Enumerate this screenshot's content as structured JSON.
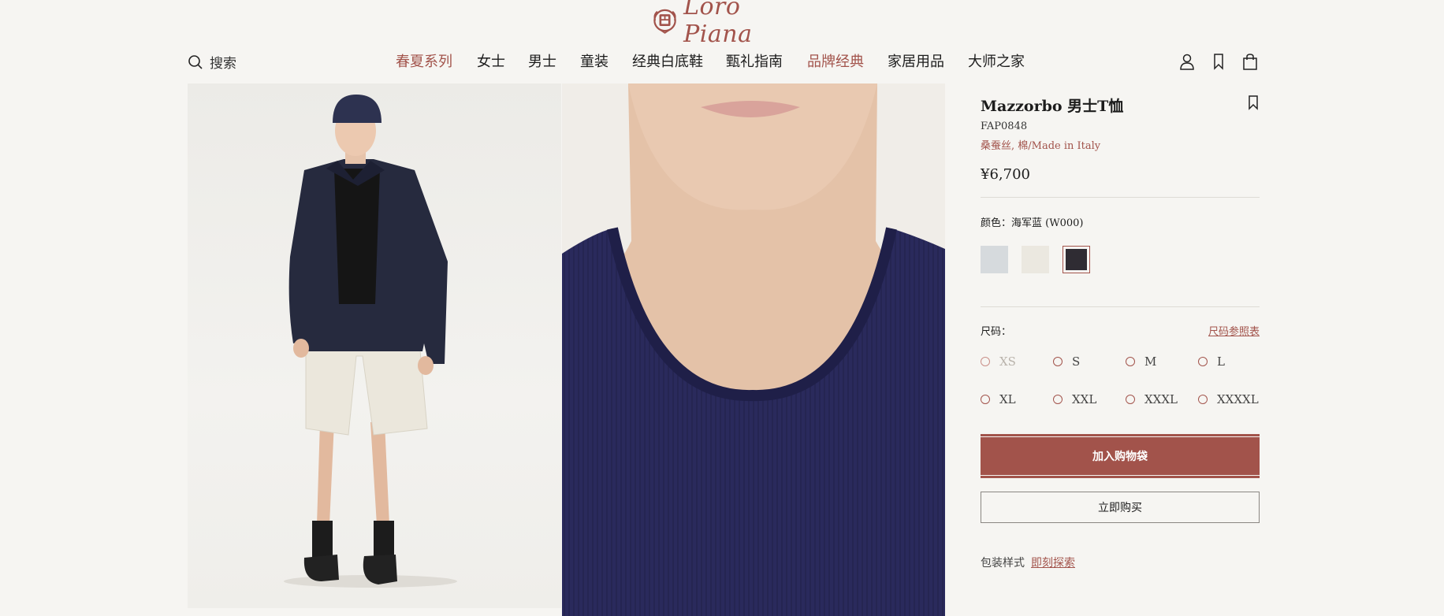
{
  "brand": {
    "name": "Loro Piana"
  },
  "header": {
    "search_label": "搜索",
    "nav": [
      {
        "label": "春夏系列",
        "accent": true
      },
      {
        "label": "女士",
        "accent": false
      },
      {
        "label": "男士",
        "accent": false
      },
      {
        "label": "童装",
        "accent": false
      },
      {
        "label": "经典白底鞋",
        "accent": false
      },
      {
        "label": "甄礼指南",
        "accent": false
      },
      {
        "label": "品牌经典",
        "accent": true
      },
      {
        "label": "家居用品",
        "accent": false
      },
      {
        "label": "大师之家",
        "accent": false
      }
    ],
    "icons": [
      "account-icon",
      "bookmark-icon",
      "shopping-bag-icon"
    ]
  },
  "product": {
    "title": "Mazzorbo 男士T恤",
    "sku": "FAP0848",
    "material": "桑蚕丝, 棉/Made in Italy",
    "price": "¥6,700",
    "color_label": "颜色：海军蓝 (W000)",
    "swatches": [
      {
        "color": "#d6dadd",
        "selected": false
      },
      {
        "color": "#ebe8e0",
        "selected": false
      },
      {
        "color": "#2f2c33",
        "selected": true
      }
    ],
    "size_label": "尺码：",
    "size_guide": "尺码参照表",
    "sizes": [
      {
        "label": "XS",
        "available": false
      },
      {
        "label": "S",
        "available": true
      },
      {
        "label": "M",
        "available": true
      },
      {
        "label": "L",
        "available": true
      },
      {
        "label": "XL",
        "available": true
      },
      {
        "label": "XXL",
        "available": true
      },
      {
        "label": "XXXL",
        "available": true
      },
      {
        "label": "XXXXL",
        "available": true
      }
    ],
    "add_to_bag": "加入购物袋",
    "buy_now": "立即购买",
    "packaging_label": "包装样式",
    "packaging_link": "即刻探索"
  },
  "colors": {
    "accent": "#a2534b",
    "background": "#f6f5f2",
    "navy": "#2a2a5c"
  }
}
